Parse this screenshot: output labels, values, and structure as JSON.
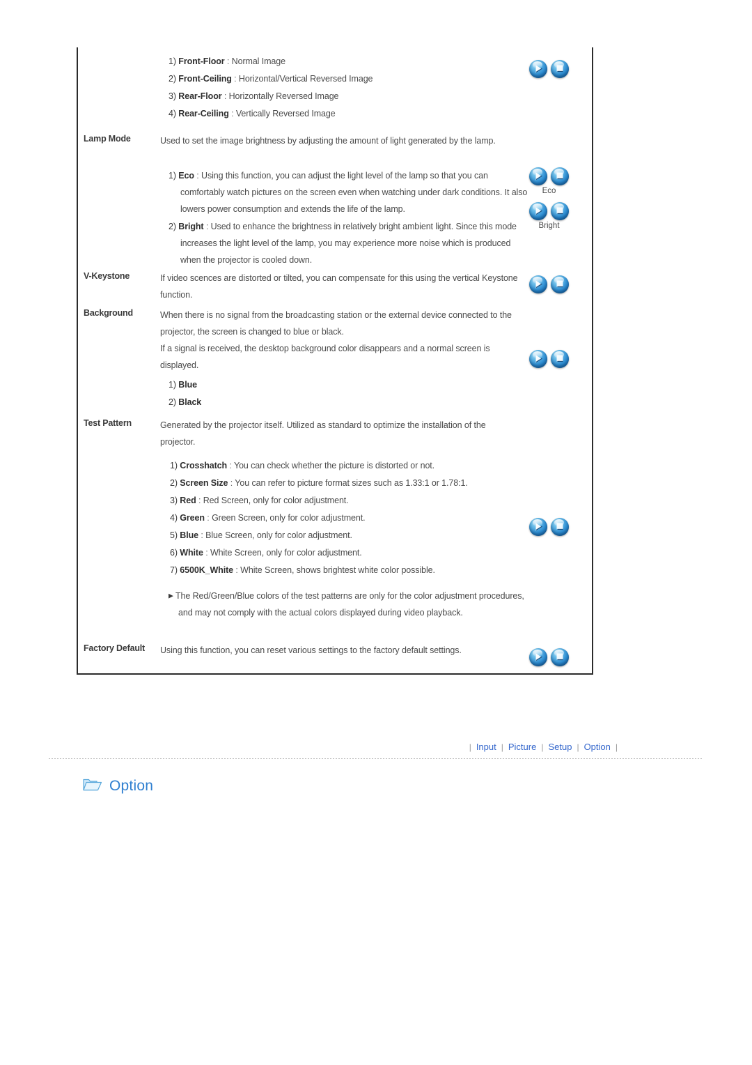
{
  "frame": {
    "projection_list": [
      {
        "index": "1)",
        "label": "Front-Floor",
        "sep": " : ",
        "text": "Normal Image"
      },
      {
        "index": "2)",
        "label": "Front-Ceiling",
        "sep": " : ",
        "text": "Horizontal/Vertical Reversed Image"
      },
      {
        "index": "3)",
        "label": "Rear-Floor",
        "sep": " : ",
        "text": "Horizontally Reversed Image"
      },
      {
        "index": "4)",
        "label": "Rear-Ceiling",
        "sep": " : ",
        "text": "Vertically Reversed Image"
      }
    ],
    "lamp_mode": {
      "term": "Lamp Mode",
      "desc": "Used to set the image brightness by adjusting the amount of light generated by the lamp.",
      "items": [
        {
          "index": "1)",
          "label": "Eco",
          "sep": " : ",
          "text": "Using this function, you can adjust the light level of the lamp so that you can comfortably watch pictures on the screen even when watching under dark conditions. It also lowers power consumption and extends the life of the lamp."
        },
        {
          "index": "2)",
          "label": "Bright",
          "sep": " : ",
          "text": "Used to enhance the brightness in relatively bright ambient light. Since this mode increases the light level of the lamp, you may experience more noise which is produced when the projector is cooled down."
        }
      ],
      "icon_labels": {
        "eco": "Eco",
        "bright": "Bright"
      }
    },
    "v_keystone": {
      "term": "V-Keystone",
      "desc": "If video scences are distorted or tilted, you can compensate for this using the vertical Keystone function."
    },
    "background": {
      "term": "Background",
      "desc_1": "When there is no signal from the broadcasting station or the external device connected to the projector, the screen is changed to blue or black.",
      "desc_2": "If a signal is received, the desktop background color disappears and a normal screen is displayed.",
      "items": [
        {
          "index": "1)",
          "label": "Blue",
          "sep": "",
          "text": ""
        },
        {
          "index": "2)",
          "label": "Black",
          "sep": "",
          "text": ""
        }
      ]
    },
    "test_pattern": {
      "term": "Test Pattern",
      "desc": "Generated by the projector itself. Utilized as standard to optimize the installation of the projector.",
      "items": [
        {
          "index": "1)",
          "label": "Crosshatch",
          "sep": " : ",
          "text": "You can check whether the picture is distorted or not."
        },
        {
          "index": "2)",
          "label": "Screen Size",
          "sep": " : ",
          "text": "You can refer to picture format sizes such as 1.33:1 or 1.78:1."
        },
        {
          "index": "3)",
          "label": "Red",
          "sep": " : ",
          "text": "Red Screen, only for color adjustment."
        },
        {
          "index": "4)",
          "label": "Green",
          "sep": " : ",
          "text": "Green Screen, only for color adjustment."
        },
        {
          "index": "5)",
          "label": "Blue",
          "sep": " : ",
          "text": "Blue Screen, only for color adjustment."
        },
        {
          "index": "6)",
          "label": "White",
          "sep": " : ",
          "text": "White Screen, only for color adjustment."
        },
        {
          "index": "7)",
          "label": "6500K_White",
          "sep": " : ",
          "text": "White Screen, shows brightest white color possible."
        }
      ],
      "note": "The Red/Green/Blue colors of the test patterns are only for the color adjustment procedures, and may not comply with the actual colors displayed during video playback.",
      "note_marker": "▶"
    },
    "factory_default": {
      "term": "Factory Default",
      "desc": "Using this function, you can reset various settings to the factory default settings."
    }
  },
  "footer": {
    "divider": "|",
    "links": [
      {
        "label": "Input"
      },
      {
        "label": "Picture"
      },
      {
        "label": "Setup"
      },
      {
        "label": "Option"
      }
    ],
    "link_color": "#3366cc"
  },
  "section": {
    "title": "Option",
    "icon": "folder-icon",
    "title_color": "#2f7fd0"
  }
}
